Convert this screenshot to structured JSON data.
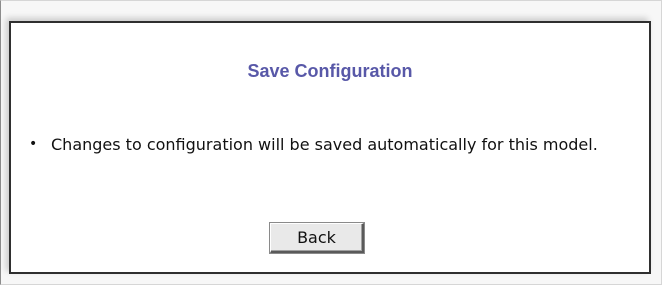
{
  "panel": {
    "title": "Save Configuration",
    "items": [
      {
        "bullet": "•",
        "text": "Changes to configuration will be saved automatically for this model."
      }
    ],
    "back_label": "Back"
  }
}
